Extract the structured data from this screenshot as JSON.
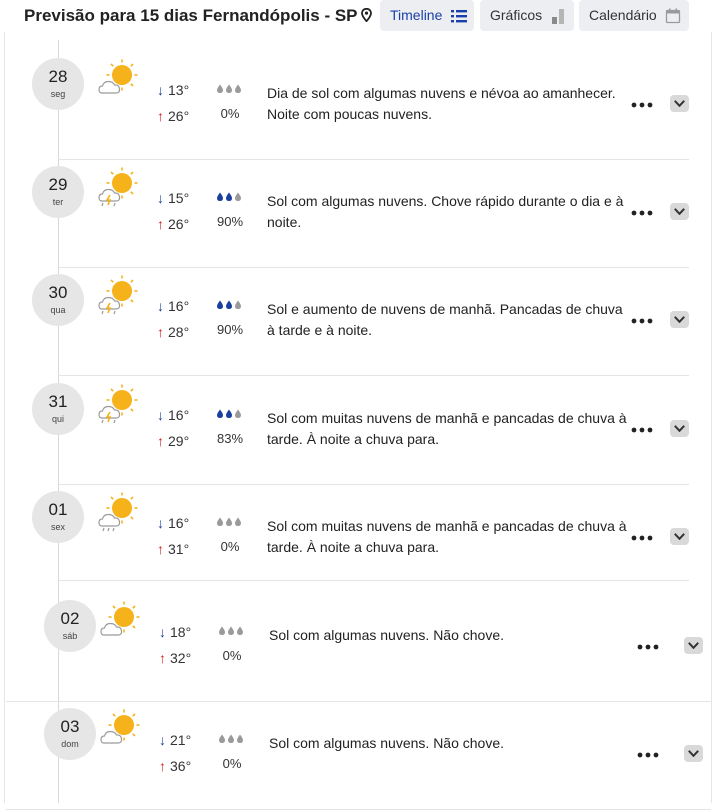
{
  "header": {
    "title": "Previsão para 15 dias Fernandópolis - SP",
    "buttons": [
      {
        "label": "Timeline",
        "icon": "list-icon",
        "active": true
      },
      {
        "label": "Gráficos",
        "icon": "bar-chart-icon",
        "active": false
      },
      {
        "label": "Calendário",
        "icon": "calendar-icon",
        "active": false
      }
    ]
  },
  "days": [
    {
      "day": "28",
      "weekday": "seg",
      "icon": "sun-cloud-icon",
      "min": "13°",
      "max": "26°",
      "rain_level": 0,
      "rain": "0%",
      "description": "Dia de sol com algumas nuvens e névoa ao amanhecer. Noite com poucas nuvens."
    },
    {
      "day": "29",
      "weekday": "ter",
      "icon": "sun-storm-icon",
      "min": "15°",
      "max": "26°",
      "rain_level": 2,
      "rain": "90%",
      "description": "Sol com algumas nuvens. Chove rápido durante o dia e à noite."
    },
    {
      "day": "30",
      "weekday": "qua",
      "icon": "sun-storm-icon",
      "min": "16°",
      "max": "28°",
      "rain_level": 2,
      "rain": "90%",
      "description": "Sol e aumento de nuvens de manhã. Pancadas de chuva à tarde e à noite."
    },
    {
      "day": "31",
      "weekday": "qui",
      "icon": "sun-storm-icon",
      "min": "16°",
      "max": "29°",
      "rain_level": 2,
      "rain": "83%",
      "description": "Sol com muitas nuvens de manhã e pancadas de chuva à tarde. À noite a chuva para."
    },
    {
      "day": "01",
      "weekday": "sex",
      "icon": "sun-cloud-rain-icon",
      "min": "16°",
      "max": "31°",
      "rain_level": 0,
      "rain": "0%",
      "description": "Sol com muitas nuvens de manhã e pancadas de chuva à tarde. À noite a chuva para."
    },
    {
      "day": "02",
      "weekday": "sáb",
      "icon": "sun-cloud-icon",
      "min": "18°",
      "max": "32°",
      "rain_level": 0,
      "rain": "0%",
      "description": "Sol com algumas nuvens. Não chove."
    },
    {
      "day": "03",
      "weekday": "dom",
      "icon": "sun-cloud-icon",
      "min": "21°",
      "max": "36°",
      "rain_level": 0,
      "rain": "0%",
      "description": "Sol com algumas nuvens. Não chove."
    }
  ],
  "colors": {
    "min_arrow": "#1b3f9f",
    "max_arrow": "#cf1f1f",
    "drop_active": "#1b3f9f",
    "drop_inactive": "#9a9a9a",
    "sun": "#f5b21a"
  }
}
